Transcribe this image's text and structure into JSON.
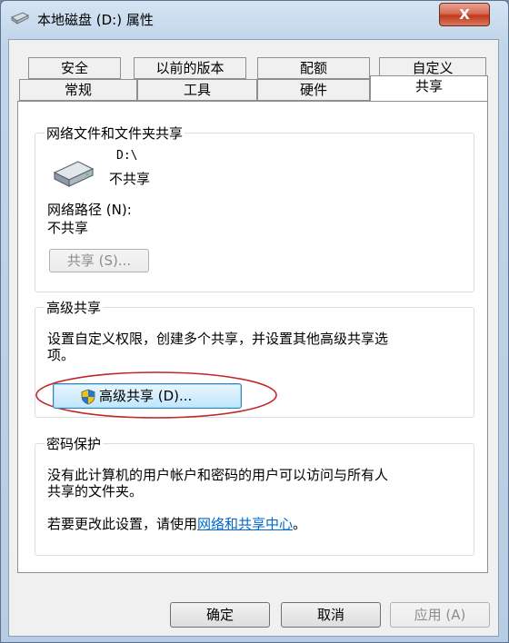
{
  "window": {
    "title": "本地磁盘 (D:) 属性",
    "close_label": "X"
  },
  "tabs_row1": [
    "安全",
    "以前的版本",
    "配额",
    "自定义"
  ],
  "tabs_row2": [
    "常规",
    "工具",
    "硬件",
    "共享"
  ],
  "network_sharing": {
    "title": "网络文件和文件夹共享",
    "drive_label": "D:\\",
    "status": "不共享",
    "path_label": "网络路径 (N):",
    "path_value": "不共享",
    "share_button": "共享 (S)..."
  },
  "advanced_sharing": {
    "title": "高级共享",
    "description_line1": "设置自定义权限，创建多个共享，并设置其他高级共享选",
    "description_line2": "项。",
    "button": "高级共享 (D)..."
  },
  "password_protection": {
    "title": "密码保护",
    "line1": "没有此计算机的用户帐户和密码的用户可以访问与所有人",
    "line2": "共享的文件夹。",
    "change_prefix": "若要更改此设置，请使用",
    "change_link": "网络和共享中心",
    "change_suffix": "。"
  },
  "buttons": {
    "ok": "确定",
    "cancel": "取消",
    "apply": "应用 (A)"
  },
  "colors": {
    "highlight_ellipse": "#c0282d",
    "link": "#0066cc"
  }
}
